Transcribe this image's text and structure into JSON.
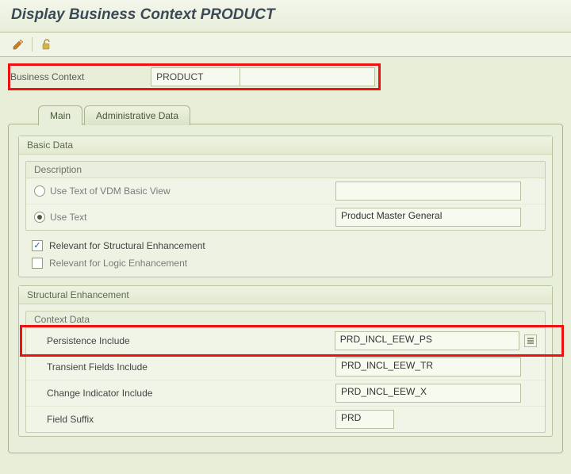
{
  "title": "Display Business Context PRODUCT",
  "toolbar": {
    "edit_icon": "pencil-icon",
    "lock_icon": "lock-open-icon"
  },
  "business_context": {
    "label": "Business Context",
    "value": "PRODUCT"
  },
  "tabs": [
    {
      "label": "Main",
      "active": true
    },
    {
      "label": "Administrative Data",
      "active": false
    }
  ],
  "main": {
    "basic_data": {
      "title": "Basic Data",
      "description": {
        "title": "Description",
        "opt_vdm": {
          "label": "Use Text of VDM Basic View",
          "selected": false,
          "value": ""
        },
        "opt_text": {
          "label": "Use Text",
          "selected": true,
          "value": "Product Master General"
        }
      },
      "relevant_structural": {
        "label": "Relevant for Structural Enhancement",
        "checked": true
      },
      "relevant_logic": {
        "label": "Relevant for Logic Enhancement",
        "checked": false
      }
    },
    "structural_enhancement": {
      "title": "Structural Enhancement",
      "context_data": {
        "title": "Context Data",
        "rows": [
          {
            "label": "Persistence Include",
            "value": "PRD_INCL_EEW_PS",
            "highlighted": true
          },
          {
            "label": "Transient Fields Include",
            "value": "PRD_INCL_EEW_TR"
          },
          {
            "label": "Change Indicator Include",
            "value": "PRD_INCL_EEW_X"
          },
          {
            "label": "Field Suffix",
            "value": "PRD",
            "small": true
          }
        ]
      }
    }
  }
}
